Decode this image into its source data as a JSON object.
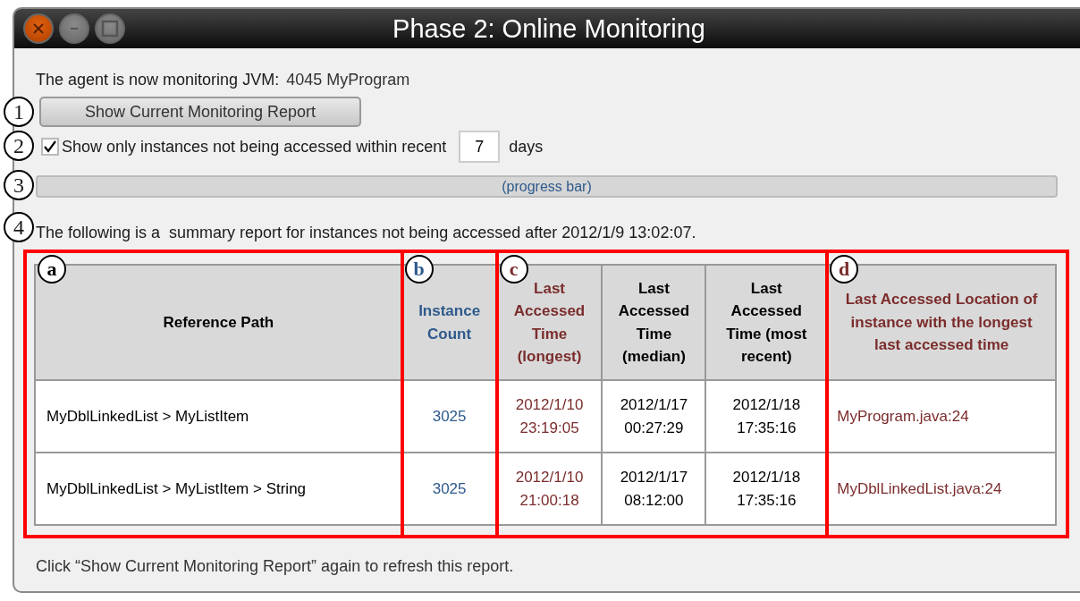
{
  "window": {
    "title": "Phase 2: Online Monitoring"
  },
  "status_text": {
    "label": "The agent is now monitoring JVM:",
    "value": "4045 MyProgram"
  },
  "report_button": {
    "label": "Show Current Monitoring Report",
    "marker": "1"
  },
  "filter": {
    "checked": true,
    "label": "Show only instances not being accessed within recent",
    "value": "7",
    "unit": "days",
    "marker": "2"
  },
  "progress": {
    "label": "(progress bar)",
    "marker": "3"
  },
  "summary": {
    "text": "The following is a  summary report for instances not being accessed after 2012/1/9 13:02:07.",
    "marker": "4"
  },
  "column_groups": [
    {
      "label": "a",
      "columns": [
        {
          "label": "Reference Path",
          "color": "#000000"
        }
      ]
    },
    {
      "label": "b",
      "columns": [
        {
          "label": "Instance Count",
          "color": "#2e5a8c"
        }
      ]
    },
    {
      "label": "c",
      "columns": [
        {
          "label": "Last Accessed Time (longest)",
          "color": "#7b2c2c"
        },
        {
          "label": "Last Accessed Time (median)",
          "color": "#000000"
        },
        {
          "label": "Last Accessed Time (most recent)",
          "color": "#000000"
        }
      ]
    },
    {
      "label": "d",
      "columns": [
        {
          "label": "Last Accessed Location of instance with the longest last accessed time",
          "color": "#7b2c2c"
        }
      ]
    }
  ],
  "rows": [
    [
      "MyDblLinkedList > MyListItem",
      "3025",
      "2012/1/10 23:19:05",
      "2012/1/17 00:27:29",
      "2012/1/18 17:35:16",
      "MyProgram.java:24"
    ],
    [
      "MyDblLinkedList > MyListItem > String",
      "3025",
      "2012/1/10 21:00:18",
      "2012/1/17 08:12:00",
      "2012/1/18 17:35:16",
      "MyDblLinkedList.java:24"
    ]
  ],
  "footer": "Click “Show Current Monitoring Report” again to refresh this report."
}
